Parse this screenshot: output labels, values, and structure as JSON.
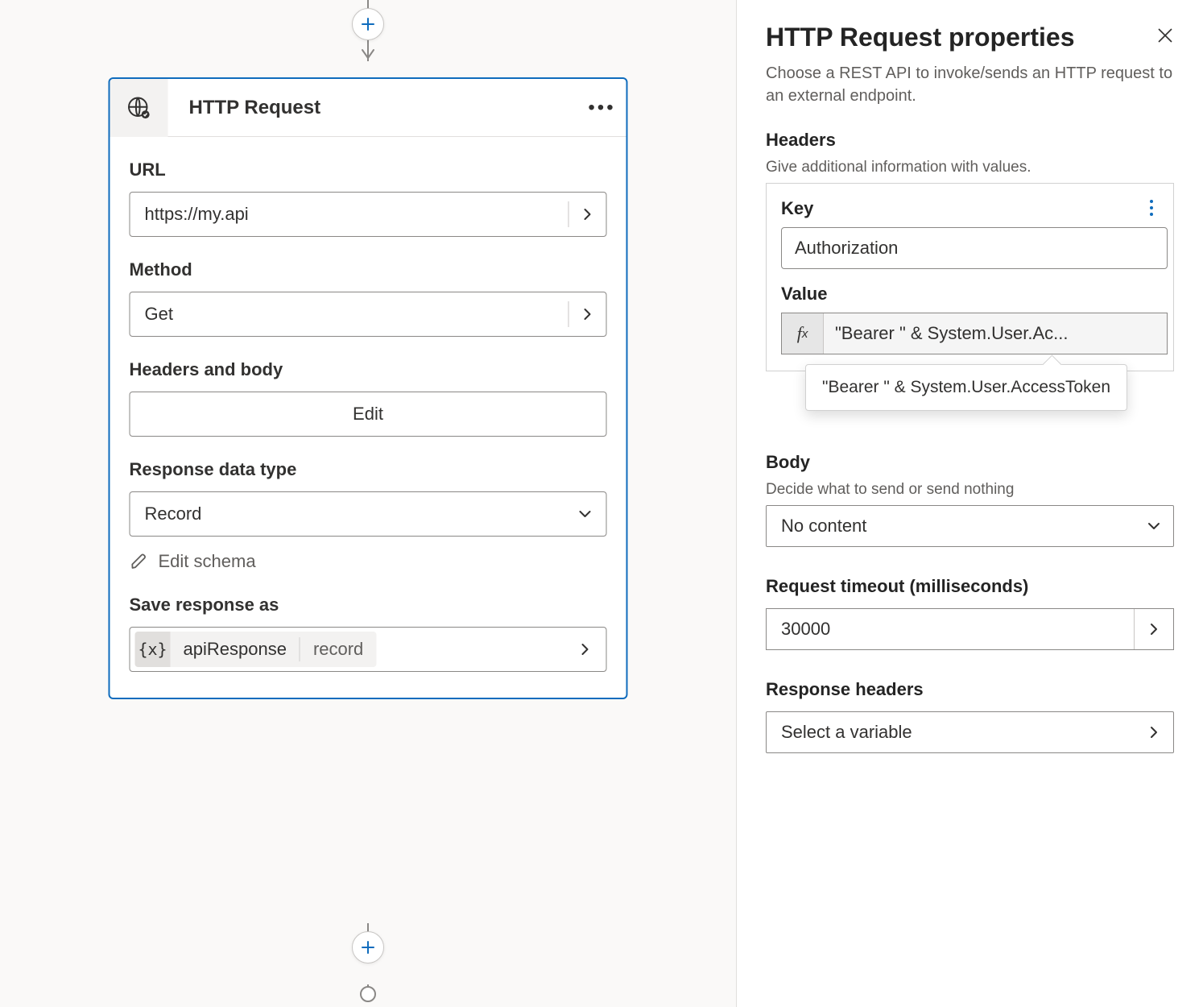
{
  "canvas": {
    "node": {
      "title": "HTTP Request",
      "url": {
        "label": "URL",
        "value": "https://my.api"
      },
      "method": {
        "label": "Method",
        "value": "Get"
      },
      "headers_body": {
        "label": "Headers and body",
        "edit": "Edit"
      },
      "response_type": {
        "label": "Response data type",
        "value": "Record"
      },
      "edit_schema": "Edit schema",
      "save_as": {
        "label": "Save response as",
        "name": "apiResponse",
        "type": "record"
      }
    }
  },
  "panel": {
    "title": "HTTP Request properties",
    "desc": "Choose a REST API to invoke/sends an HTTP request to an external endpoint.",
    "headers": {
      "title": "Headers",
      "hint": "Give additional information with values.",
      "key_label": "Key",
      "key_value": "Authorization",
      "value_label": "Value",
      "fx_short": "\"Bearer \" & System.User.Ac...",
      "fx_full": "\"Bearer \" & System.User.AccessToken"
    },
    "body": {
      "title": "Body",
      "hint": "Decide what to send or send nothing",
      "value": "No content"
    },
    "timeout": {
      "title": "Request timeout (milliseconds)",
      "value": "30000"
    },
    "resp_headers": {
      "title": "Response headers",
      "placeholder": "Select a variable"
    }
  }
}
